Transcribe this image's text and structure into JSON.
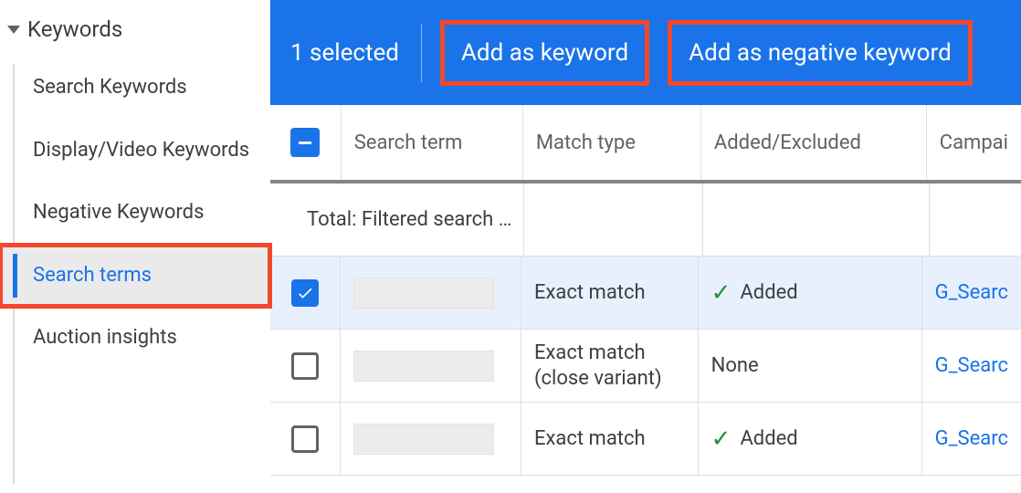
{
  "sidebar": {
    "header": "Keywords",
    "items": [
      {
        "label": "Search Keywords",
        "active": false
      },
      {
        "label": "Display/Video Keywords",
        "active": false
      },
      {
        "label": "Negative Keywords",
        "active": false
      },
      {
        "label": "Search terms",
        "active": true
      },
      {
        "label": "Auction insights",
        "active": false
      }
    ]
  },
  "actionbar": {
    "selected_text": "1 selected",
    "add_keyword": "Add as keyword",
    "add_negative": "Add as negative keyword"
  },
  "table": {
    "headers": {
      "search_term": "Search term",
      "match_type": "Match type",
      "added_excluded": "Added/Excluded",
      "campaign": "Campai"
    },
    "total_label": "Total: Filtered search …",
    "rows": [
      {
        "checked": true,
        "match_type": "Exact match",
        "added_status": "Added",
        "added_icon": true,
        "campaign": "G_Searc"
      },
      {
        "checked": false,
        "match_type": "Exact match (close variant)",
        "added_status": "None",
        "added_icon": false,
        "campaign": "G_Searc"
      },
      {
        "checked": false,
        "match_type": "Exact match",
        "added_status": "Added",
        "added_icon": true,
        "campaign": "G_Searc"
      }
    ]
  }
}
